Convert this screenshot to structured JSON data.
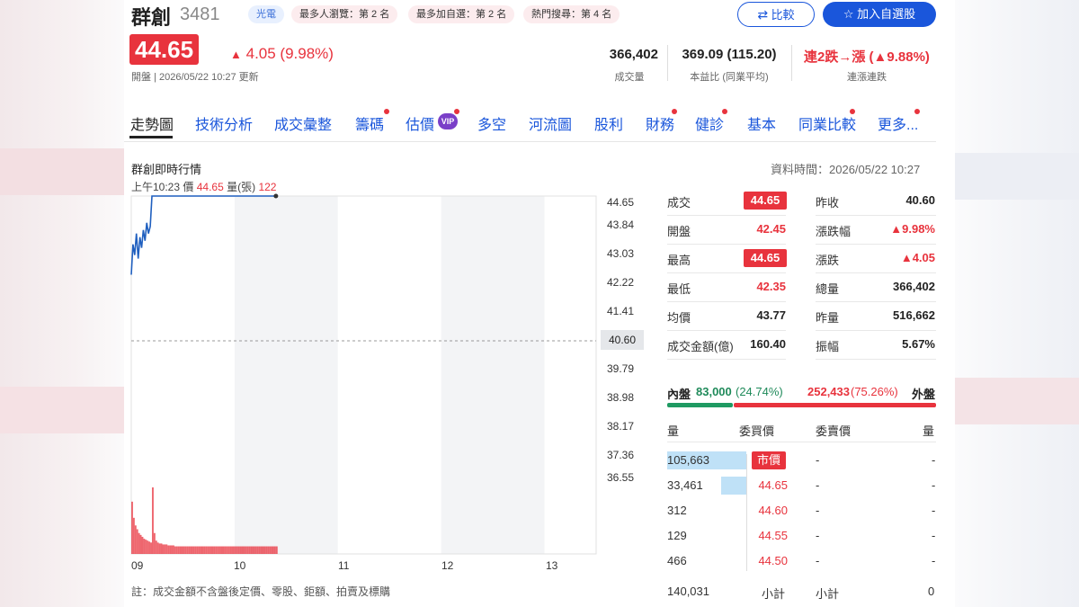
{
  "header": {
    "stock_name": "群創",
    "stock_code": "3481",
    "tags": [
      "光電",
      "最多人瀏覽：第 2 名",
      "最多加自選：第 2 名",
      "熱門搜尋：第 4 名"
    ],
    "compare_label": "比較",
    "add_watchlist_label": "加入自選股",
    "price": "44.65",
    "change": "4.05 (9.98%)",
    "sub_info": "開盤 | 2026/05/22 10:27 更新",
    "stats": [
      {
        "value": "366,402",
        "label": "成交量"
      },
      {
        "value": "369.09 (115.20)",
        "label": "本益比 (同業平均)"
      },
      {
        "value": "連2跌→漲 (▲9.88%)",
        "label": "連漲連跌"
      }
    ]
  },
  "tabs": [
    "走勢圖",
    "技術分析",
    "成交彙整",
    "籌碼",
    "估價",
    "多空",
    "河流圖",
    "股利",
    "財務",
    "健診",
    "基本",
    "同業比較",
    "更多..."
  ],
  "vip_label": "VIP",
  "chart_header": {
    "title": "群創即時行情",
    "data_time": "資料時間：2026/05/22 10:27",
    "tooltip_time": "上午10:23",
    "tooltip_price_label": "價",
    "tooltip_price": "44.65",
    "tooltip_volume_label": "量(張)",
    "tooltip_volume": "122"
  },
  "chart_data": {
    "type": "line",
    "y_ticks": [
      "44.65",
      "43.84",
      "43.03",
      "42.22",
      "41.41",
      "40.60",
      "39.79",
      "38.98",
      "38.17",
      "37.36",
      "36.55"
    ],
    "x_ticks": [
      "09",
      "10",
      "11",
      "12",
      "13"
    ],
    "ylim": [
      36.55,
      44.65
    ],
    "reference_price": 40.6,
    "price_series": [
      42.45,
      43.3,
      43.0,
      43.6,
      42.9,
      43.5,
      43.2,
      43.7,
      43.4,
      43.9,
      43.6,
      43.8,
      44.65,
      44.65,
      44.65,
      44.65,
      44.65,
      44.65,
      44.65,
      44.65,
      44.65,
      44.65,
      44.65,
      44.65,
      44.65,
      44.65,
      44.65,
      44.65,
      44.65,
      44.65,
      44.65,
      44.65,
      44.65,
      44.65,
      44.65,
      44.65,
      44.65,
      44.65,
      44.65,
      44.65,
      44.65,
      44.65,
      44.65,
      44.65,
      44.65,
      44.65,
      44.65,
      44.65,
      44.65,
      44.65,
      44.65,
      44.65,
      44.65,
      44.65,
      44.65,
      44.65,
      44.65,
      44.65,
      44.65,
      44.65,
      44.65,
      44.65,
      44.65,
      44.65,
      44.65,
      44.65,
      44.65,
      44.65,
      44.65,
      44.65,
      44.65,
      44.65,
      44.65,
      44.65,
      44.65,
      44.65,
      44.65,
      44.65,
      44.65,
      44.65,
      44.65,
      44.65,
      44.65,
      44.65,
      44.65
    ],
    "volume_series": [
      55,
      38,
      30,
      26,
      22,
      20,
      18,
      16,
      15,
      14,
      13,
      12,
      70,
      22,
      14,
      12,
      11,
      11,
      10,
      10,
      10,
      9,
      9,
      9,
      9,
      8,
      8,
      8,
      8,
      8,
      8,
      8,
      8,
      8,
      8,
      8,
      8,
      8,
      8,
      8,
      8,
      8,
      8,
      8,
      8,
      8,
      8,
      8,
      8,
      8,
      8,
      8,
      8,
      8,
      8,
      8,
      8,
      8,
      8,
      8,
      8,
      8,
      8,
      8,
      8,
      8,
      8,
      8,
      8,
      8,
      8,
      8,
      8,
      8,
      8,
      8,
      8,
      8,
      8,
      8,
      8,
      8,
      8,
      8,
      8
    ],
    "minutes_total": 270,
    "line_color": "#1f5fbf",
    "volume_color": "#e8333d"
  },
  "note": "註：成交金額不含盤後定價、零股、鉅額、拍賣及標購",
  "quote_table": {
    "left": [
      {
        "label": "成交",
        "value": "44.65",
        "boxed": true
      },
      {
        "label": "開盤",
        "value": "42.45",
        "boxed": false
      },
      {
        "label": "最高",
        "value": "44.65",
        "boxed": true
      },
      {
        "label": "最低",
        "value": "42.35",
        "boxed": false
      },
      {
        "label": "均價",
        "value": "43.77",
        "boxed": false
      },
      {
        "label": "成交金額(億)",
        "value": "160.40",
        "boxed": false
      }
    ],
    "right": [
      {
        "label": "昨收",
        "value": "40.60"
      },
      {
        "label": "漲跌幅",
        "value": "▲9.98%"
      },
      {
        "label": "漲跌",
        "value": "▲4.05"
      },
      {
        "label": "總量",
        "value": "366,402"
      },
      {
        "label": "昨量",
        "value": "516,662"
      },
      {
        "label": "振幅",
        "value": "5.67%"
      }
    ]
  },
  "inner_outer": {
    "inner_label": "內盤",
    "inner_value": "83,000",
    "inner_pct": "(24.74%)",
    "outer_value": "252,433",
    "outer_pct": "(75.26%)",
    "outer_label": "外盤",
    "inner_ratio": 0.2474
  },
  "order_book": {
    "headers": [
      "量",
      "委買價",
      "委賣價",
      "量"
    ],
    "rows": [
      {
        "bid_vol": "105,663",
        "bid_price": "市價",
        "ask_price": "-",
        "ask_vol": "-",
        "bar_ratio": 1.0
      },
      {
        "bid_vol": "33,461",
        "bid_price": "44.65",
        "ask_price": "-",
        "ask_vol": "-",
        "bar_ratio": 0.32
      },
      {
        "bid_vol": "312",
        "bid_price": "44.60",
        "ask_price": "-",
        "ask_vol": "-",
        "bar_ratio": 0.0
      },
      {
        "bid_vol": "129",
        "bid_price": "44.55",
        "ask_price": "-",
        "ask_vol": "-",
        "bar_ratio": 0.0
      },
      {
        "bid_vol": "466",
        "bid_price": "44.50",
        "ask_price": "-",
        "ask_vol": "-",
        "bar_ratio": 0.0
      }
    ],
    "subtotal_bid_vol": "140,031",
    "subtotal_label": "小計",
    "subtotal_ask_label": "小計",
    "subtotal_ask_vol": "0"
  }
}
